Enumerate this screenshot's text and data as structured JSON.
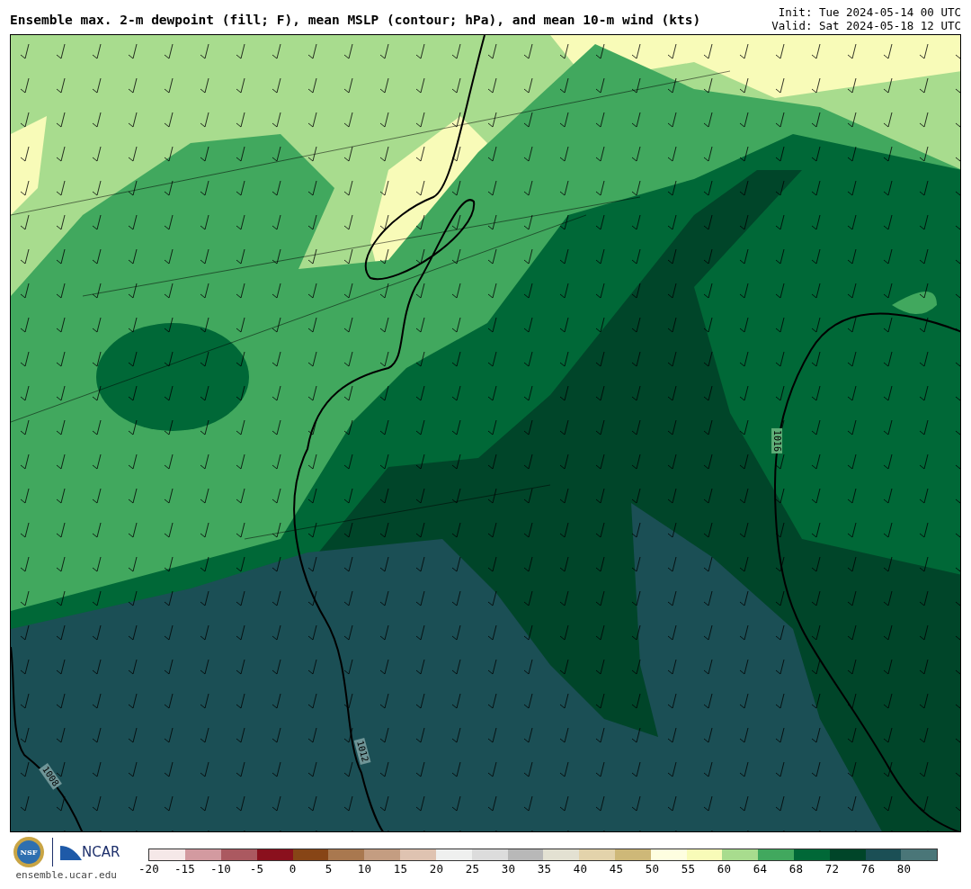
{
  "title": "Ensemble max. 2-m dewpoint (fill; F), mean MSLP (contour; hPa), and mean 10-m wind (kts)",
  "times": [
    "Init: Tue 2024-05-14 00 UTC",
    "Valid: Sat 2024-05-18 12 UTC"
  ],
  "map": {
    "contour_labels": [
      "1016",
      "1012",
      "1008"
    ]
  },
  "logos": [
    "NSF",
    "NCAR"
  ],
  "site": "ensemble.ucar.edu",
  "colorbar": [
    {
      "label": "-20",
      "color": "#f5e8e8"
    },
    {
      "label": "-15",
      "color": "#d39aa0"
    },
    {
      "label": "-10",
      "color": "#ab5960"
    },
    {
      "label": "-5",
      "color": "#8a101d"
    },
    {
      "label": "0",
      "color": "#874516"
    },
    {
      "label": "5",
      "color": "#a9784f"
    },
    {
      "label": "10",
      "color": "#c49d81"
    },
    {
      "label": "15",
      "color": "#dfc3b1"
    },
    {
      "label": "20",
      "color": "#eff0ef"
    },
    {
      "label": "25",
      "color": "#dcdcdc"
    },
    {
      "label": "30",
      "color": "#b8b8b8"
    },
    {
      "label": "35",
      "color": "#e3e1d2"
    },
    {
      "label": "40",
      "color": "#e3d3ab"
    },
    {
      "label": "45",
      "color": "#ceb878"
    },
    {
      "label": "50",
      "color": "#fefee0"
    },
    {
      "label": "55",
      "color": "#f8fbb8"
    },
    {
      "label": "60",
      "color": "#a8dc8e"
    },
    {
      "label": "64",
      "color": "#41a85e"
    },
    {
      "label": "68",
      "color": "#006837"
    },
    {
      "label": "72",
      "color": "#004529"
    },
    {
      "label": "76",
      "color": "#1b4f55"
    },
    {
      "label": "80",
      "color": "#4a7678"
    }
  ]
}
